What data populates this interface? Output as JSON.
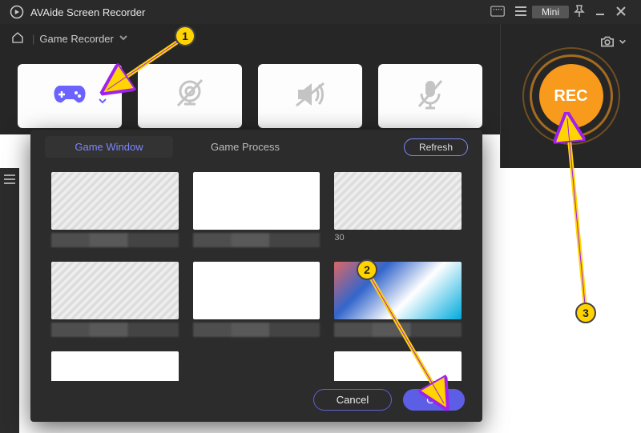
{
  "titlebar": {
    "app_name": "AVAide Screen Recorder",
    "mini_label": "Mini"
  },
  "topbar": {
    "mode_label": "Game Recorder"
  },
  "cards": {
    "game_icon": "game-controller-icon",
    "webcam_icon": "webcam-off-icon",
    "speaker_icon": "speaker-off-icon",
    "mic_icon": "mic-off-icon"
  },
  "rec": {
    "label": "REC"
  },
  "popup": {
    "tab_window": "Game Window",
    "tab_process": "Game Process",
    "refresh": "Refresh",
    "cancel": "Cancel",
    "ok": "OK",
    "item3_caption": "30"
  },
  "annotations": {
    "b1": "1",
    "b2": "2",
    "b3": "3"
  }
}
